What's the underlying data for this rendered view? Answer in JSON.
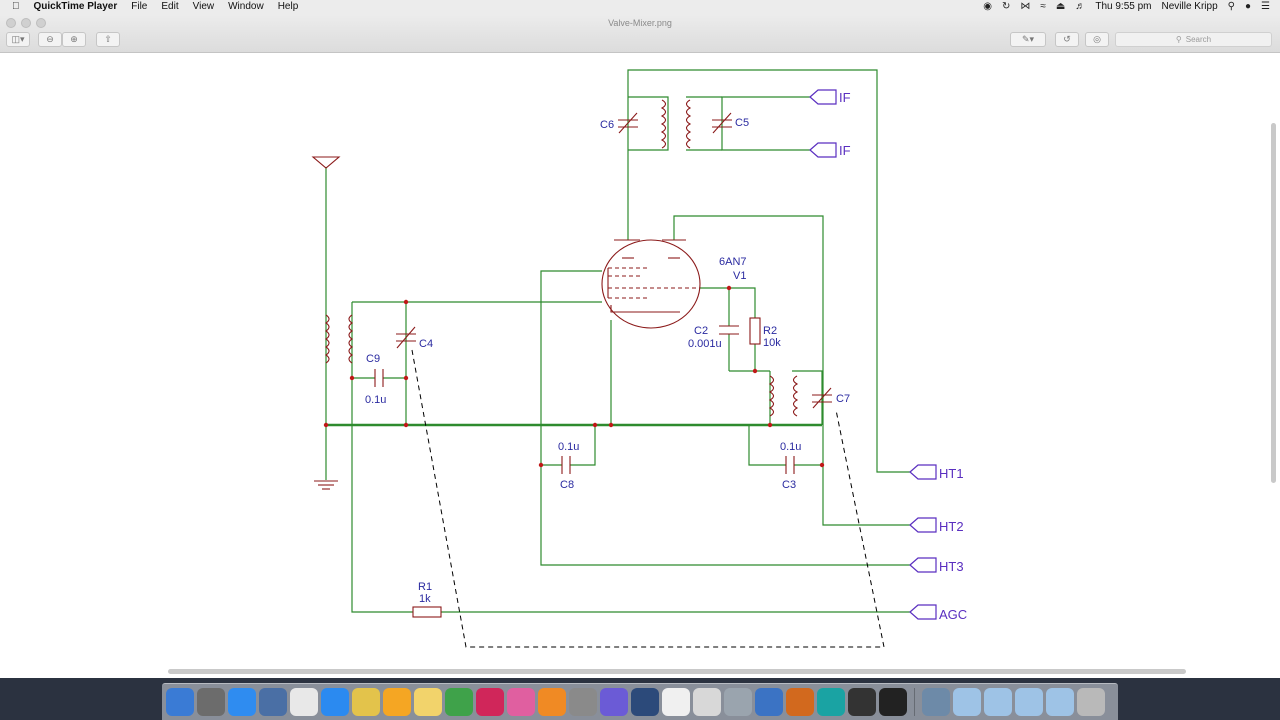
{
  "menubar": {
    "app": "QuickTime Player",
    "items": [
      "File",
      "Edit",
      "View",
      "Window",
      "Help"
    ],
    "clock": "Thu 9:55 pm",
    "user": "Neville Kripp"
  },
  "window": {
    "title": "Valve-Mixer.png"
  },
  "toolbar": {
    "search_placeholder": "Search"
  },
  "schematic": {
    "labels": {
      "c6": "C6",
      "c5": "C5",
      "if1": "IF",
      "if2": "IF",
      "valve_type": "6AN7",
      "valve_ref": "V1",
      "c2": "C2",
      "c2_val": "0.001u",
      "r2": "R2",
      "r2_val": "10k",
      "c4": "C4",
      "c9": "C9",
      "c9_val": "0.1u",
      "c7": "C7",
      "c8": "C8",
      "c8_val": "0.1u",
      "c3": "C3",
      "c3_val": "0.1u",
      "r1": "R1",
      "r1_val": "1k",
      "ht1": "HT1",
      "ht2": "HT2",
      "ht3": "HT3",
      "agc": "AGC"
    },
    "colors": {
      "wire": "#2e8b2e",
      "component": "#8b1a1a",
      "port": "#5a2fc0",
      "dashed": "#000000"
    }
  },
  "dock": {
    "icons": [
      "finder-icon",
      "launchpad-icon",
      "app-store-icon",
      "preview-icon",
      "calendar-icon",
      "safari-icon",
      "chrome-icon",
      "photos-icon",
      "notes-icon",
      "numbers-icon",
      "kindle-icon",
      "itunes-icon",
      "ibooks-icon",
      "system-preferences-icon",
      "imovie-icon",
      "quicktime-icon",
      "textedit-icon",
      "calculator-icon",
      "database-icon",
      "xcode-icon",
      "fusion-icon",
      "arduino-icon",
      "activity-monitor-icon",
      "terminal-icon",
      "screenshot-icon",
      "folder-icon",
      "folder-icon",
      "folder-icon",
      "folder-icon",
      "trash-icon"
    ]
  }
}
